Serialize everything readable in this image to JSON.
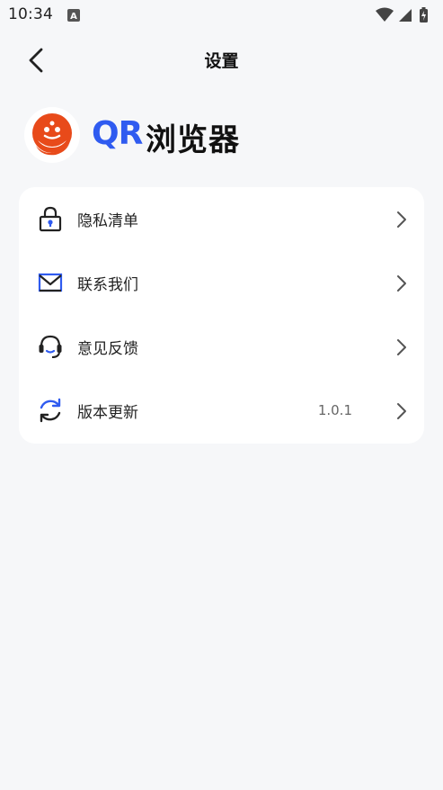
{
  "status_bar": {
    "time": "10:34",
    "notification_icon": "a-notification-icon",
    "wifi_icon": "wifi-icon",
    "signal_icon": "signal-icon",
    "battery_icon": "battery-charging-icon"
  },
  "nav": {
    "title": "设置",
    "back_icon": "chevron-left-icon"
  },
  "brand": {
    "qr_text": "QR",
    "name": "浏览器",
    "colors": {
      "qr": "#2f5bf0",
      "logo_primary": "#e84a1a"
    }
  },
  "menu": {
    "items": [
      {
        "label": "隐私清单",
        "icon": "lock-icon",
        "value": ""
      },
      {
        "label": "联系我们",
        "icon": "mail-icon",
        "value": ""
      },
      {
        "label": "意见反馈",
        "icon": "headset-icon",
        "value": ""
      },
      {
        "label": "版本更新",
        "icon": "refresh-icon",
        "value": "1.0.1"
      }
    ],
    "accent_color": "#2f5bf0"
  }
}
